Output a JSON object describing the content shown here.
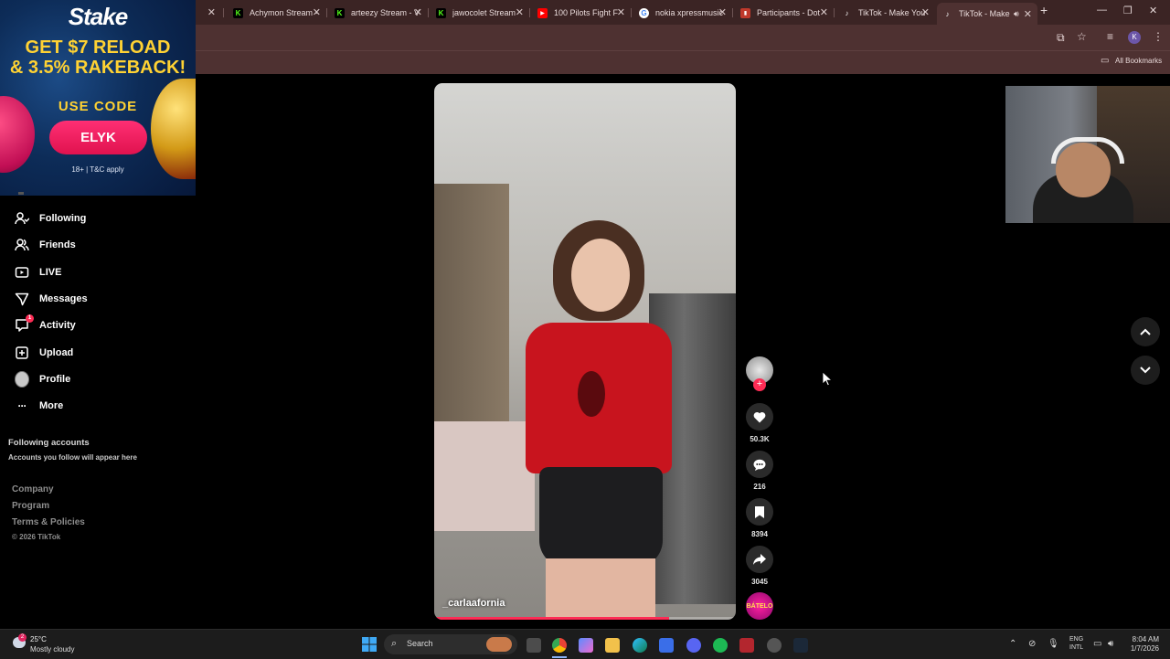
{
  "browser": {
    "tabs": [
      {
        "title": "Achymon Stream - ",
        "favicon": "kick-icon",
        "color": "#53fc18"
      },
      {
        "title": "arteezy Stream - V",
        "favicon": "kick-icon",
        "color": "#53fc18"
      },
      {
        "title": "jawocolet Stream",
        "favicon": "kick-icon",
        "color": "#53fc18"
      },
      {
        "title": "100 Pilots Fight F",
        "favicon": "youtube-icon",
        "color": "#ff0000"
      },
      {
        "title": "nokia xpressmusic",
        "favicon": "google-icon",
        "color": "#ffffff"
      },
      {
        "title": "Participants - Dot",
        "favicon": "dotabuff-icon",
        "color": "#c0392b"
      },
      {
        "title": "TikTok - Make You",
        "favicon": "tiktok-icon",
        "color": "#ffffff"
      },
      {
        "title": "TikTok - Make",
        "favicon": "tiktok-icon",
        "color": "#ffffff"
      }
    ],
    "new_tab": "+",
    "bookmarks_label": "All Bookmarks",
    "profile_initial": "K"
  },
  "ad": {
    "brand": "Stake",
    "headline_1": "GET $7 RELOAD",
    "headline_2": "& 3.5% RAKEBACK!",
    "use_code": "USE CODE",
    "code": "ELYK",
    "terms": "18+ | T&C apply"
  },
  "sidebar": {
    "items": [
      {
        "label": "Following",
        "icon": "following-icon"
      },
      {
        "label": "Friends",
        "icon": "friends-icon"
      },
      {
        "label": "LIVE",
        "icon": "live-icon"
      },
      {
        "label": "Messages",
        "icon": "messages-icon"
      },
      {
        "label": "Activity",
        "icon": "activity-icon",
        "badge": "1"
      },
      {
        "label": "Upload",
        "icon": "upload-icon"
      },
      {
        "label": "Profile",
        "icon": "avatar"
      },
      {
        "label": "More",
        "icon": "more-icon"
      }
    ],
    "following_title": "Following accounts",
    "following_sub": "Accounts you follow will appear here",
    "footer": [
      "Company",
      "Program",
      "Terms & Policies"
    ],
    "copyright": "© 2026 TikTok"
  },
  "video": {
    "username": "_carlaafornia",
    "progress": 0.78
  },
  "actions": {
    "likes": "50.3K",
    "comments": "216",
    "saves": "8394",
    "shares": "3045",
    "sound_label": "BÁTELO"
  },
  "taskbar": {
    "weather_temp": "25°C",
    "weather_desc": "Mostly cloudy",
    "weather_badge": "2",
    "search": "Search",
    "lang_1": "ENG",
    "lang_2": "INTL",
    "time": "8:04 AM",
    "date": "1/7/2026"
  }
}
